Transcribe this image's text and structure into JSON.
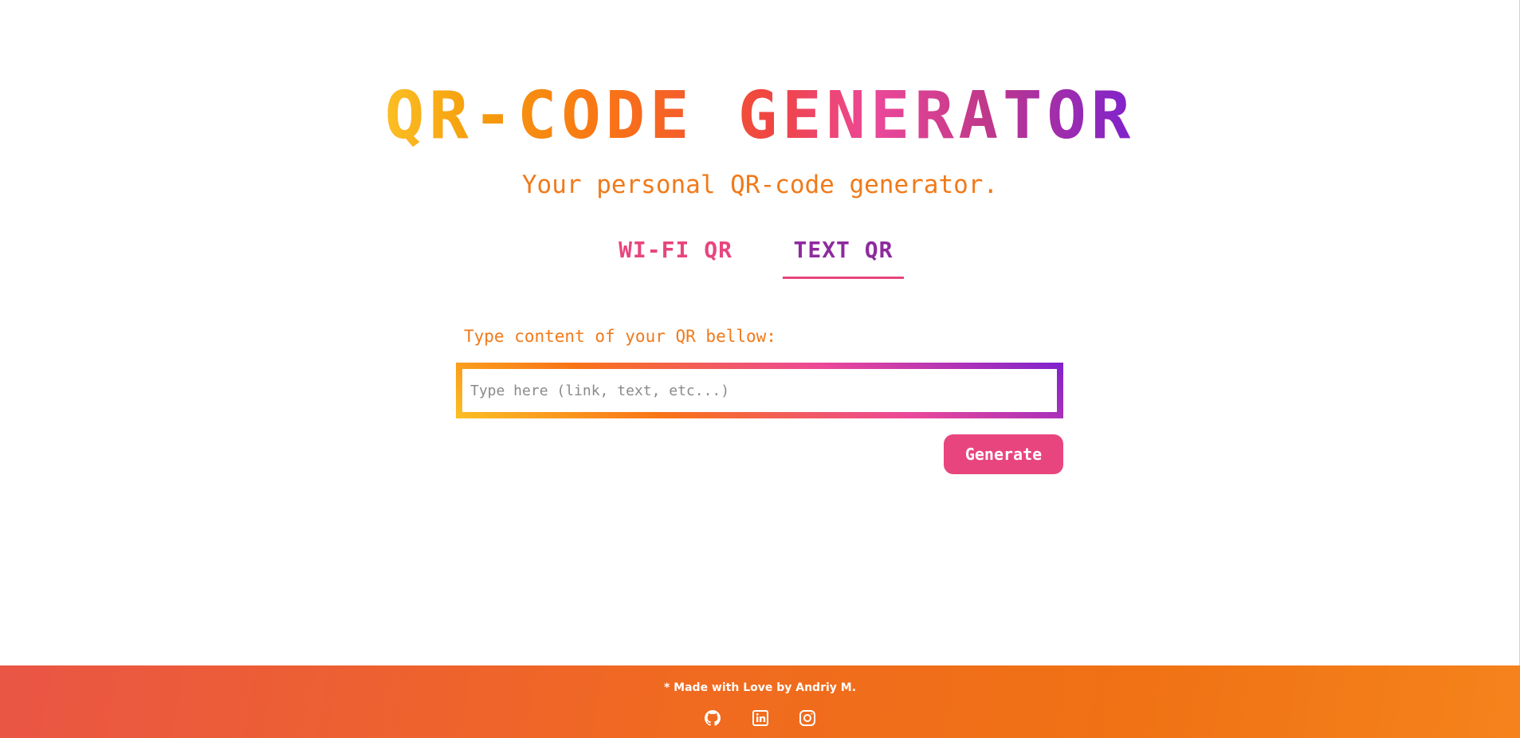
{
  "header": {
    "title": "QR-CODE GENERATOR",
    "subtitle": "Your personal QR-code generator."
  },
  "tabs": [
    {
      "label": "WI-FI QR",
      "active": false
    },
    {
      "label": "TEXT QR",
      "active": true
    }
  ],
  "form": {
    "label": "Type content of your QR bellow:",
    "input_value": "",
    "input_placeholder": "Type here (link, text, etc...)",
    "generate_label": "Generate"
  },
  "footer": {
    "credit": "* Made with Love by Andriy M.",
    "social_icons": [
      "github-icon",
      "linkedin-icon",
      "instagram-icon"
    ]
  },
  "colors": {
    "accent_pink": "#e8457e",
    "accent_orange": "#f07a1a",
    "accent_purple": "#8e2a9e",
    "gradient_start": "#fbbf24",
    "gradient_end": "#7e22ce"
  }
}
